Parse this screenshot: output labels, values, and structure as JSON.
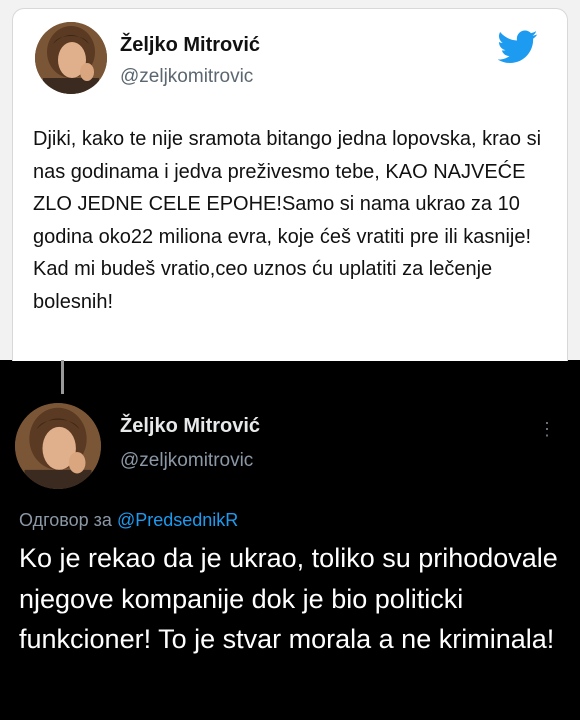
{
  "top_tweet": {
    "author_name": "Željko Mitrović",
    "author_handle": "@zeljkomitrovic",
    "brand_icon": "twitter-bird-icon",
    "text": "Djiki, kako te nije sramota bitango jedna lopovska, krao si nas godinama i jedva preživesmo tebe, KAO NAJVEĆE ZLO JEDNE CELE EPOHE!Samo si nama ukrao za 10 godina oko22 miliona evra, koje ćeš vratiti pre ili kasnije! Kad mi budeš vratio,ceo uznos ću uplatiti za lečenje bolesnih!"
  },
  "reply_tweet": {
    "author_name": "Željko Mitrović",
    "author_handle": "@zeljkomitrovic",
    "reply_prefix": "Одговор за",
    "reply_mention": "@PredsednikR",
    "text": "Ko je rekao da je ukrao, toliko su prihodovale njegove kompanije dok je bio politicki funkcioner! To je stvar morala a ne kriminala!"
  },
  "colors": {
    "twitter_blue": "#1d9bf0",
    "dark_background": "#000000",
    "light_card": "#ffffff"
  }
}
